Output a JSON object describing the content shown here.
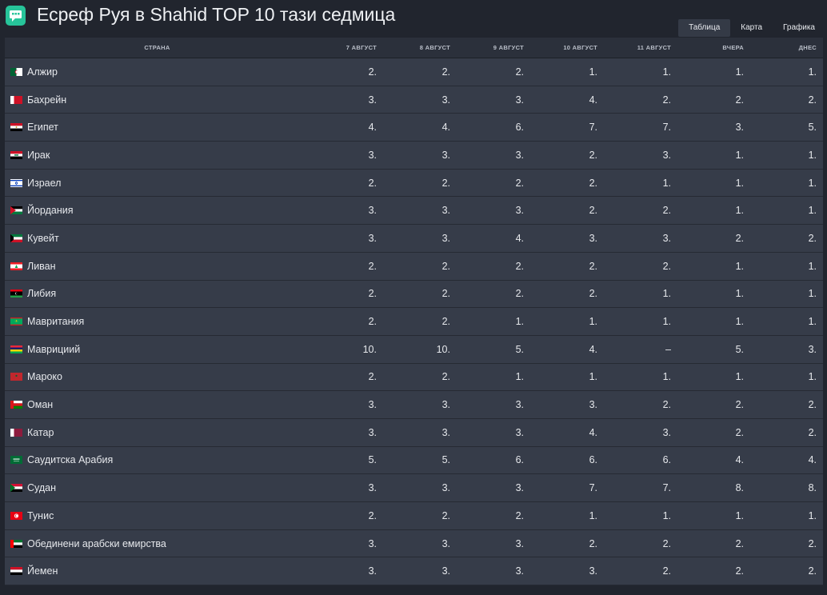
{
  "app": {
    "title": "Есреф Руя в Shahid TOP 10 тази седмица",
    "logo_icon": "chat-bubble-icon",
    "accent": "#27c49a"
  },
  "tabs": [
    {
      "label": "Таблица",
      "active": true
    },
    {
      "label": "Карта",
      "active": false
    },
    {
      "label": "Графика",
      "active": false
    }
  ],
  "table": {
    "headers": [
      "Страна",
      "7 август",
      "8 август",
      "9 август",
      "10 август",
      "11 август",
      "Вчера",
      "Днес"
    ],
    "rows": [
      {
        "country": "Алжир",
        "flag": "algeria",
        "values": [
          "2.",
          "2.",
          "2.",
          "1.",
          "1.",
          "1.",
          "1."
        ]
      },
      {
        "country": "Бахрейн",
        "flag": "bahrain",
        "values": [
          "3.",
          "3.",
          "3.",
          "4.",
          "2.",
          "2.",
          "2."
        ]
      },
      {
        "country": "Египет",
        "flag": "egypt",
        "values": [
          "4.",
          "4.",
          "6.",
          "7.",
          "7.",
          "3.",
          "5."
        ]
      },
      {
        "country": "Ирак",
        "flag": "iraq",
        "values": [
          "3.",
          "3.",
          "3.",
          "2.",
          "3.",
          "1.",
          "1."
        ]
      },
      {
        "country": "Израел",
        "flag": "israel",
        "values": [
          "2.",
          "2.",
          "2.",
          "2.",
          "1.",
          "1.",
          "1."
        ]
      },
      {
        "country": "Йордания",
        "flag": "jordan",
        "values": [
          "3.",
          "3.",
          "3.",
          "2.",
          "2.",
          "1.",
          "1."
        ]
      },
      {
        "country": "Кувейт",
        "flag": "kuwait",
        "values": [
          "3.",
          "3.",
          "4.",
          "3.",
          "3.",
          "2.",
          "2."
        ]
      },
      {
        "country": "Ливан",
        "flag": "lebanon",
        "values": [
          "2.",
          "2.",
          "2.",
          "2.",
          "2.",
          "1.",
          "1."
        ]
      },
      {
        "country": "Либия",
        "flag": "libya",
        "values": [
          "2.",
          "2.",
          "2.",
          "2.",
          "1.",
          "1.",
          "1."
        ]
      },
      {
        "country": "Мавритания",
        "flag": "mauritania",
        "values": [
          "2.",
          "2.",
          "1.",
          "1.",
          "1.",
          "1.",
          "1."
        ]
      },
      {
        "country": "Маврициий",
        "flag": "mauritius",
        "values": [
          "10.",
          "10.",
          "5.",
          "4.",
          "–",
          "5.",
          "3."
        ]
      },
      {
        "country": "Мароко",
        "flag": "morocco",
        "values": [
          "2.",
          "2.",
          "1.",
          "1.",
          "1.",
          "1.",
          "1."
        ]
      },
      {
        "country": "Оман",
        "flag": "oman",
        "values": [
          "3.",
          "3.",
          "3.",
          "3.",
          "2.",
          "2.",
          "2."
        ]
      },
      {
        "country": "Катар",
        "flag": "qatar",
        "values": [
          "3.",
          "3.",
          "3.",
          "4.",
          "3.",
          "2.",
          "2."
        ]
      },
      {
        "country": "Саудитска Арабия",
        "flag": "saudi-arabia",
        "values": [
          "5.",
          "5.",
          "6.",
          "6.",
          "6.",
          "4.",
          "4."
        ]
      },
      {
        "country": "Судан",
        "flag": "sudan",
        "values": [
          "3.",
          "3.",
          "3.",
          "7.",
          "7.",
          "8.",
          "8."
        ]
      },
      {
        "country": "Тунис",
        "flag": "tunisia",
        "values": [
          "2.",
          "2.",
          "2.",
          "1.",
          "1.",
          "1.",
          "1."
        ]
      },
      {
        "country": "Обединени арабски емирства",
        "flag": "uae",
        "values": [
          "3.",
          "3.",
          "3.",
          "2.",
          "2.",
          "2.",
          "2."
        ]
      },
      {
        "country": "Йемен",
        "flag": "yemen",
        "values": [
          "3.",
          "3.",
          "3.",
          "3.",
          "2.",
          "2.",
          "2."
        ]
      }
    ]
  }
}
